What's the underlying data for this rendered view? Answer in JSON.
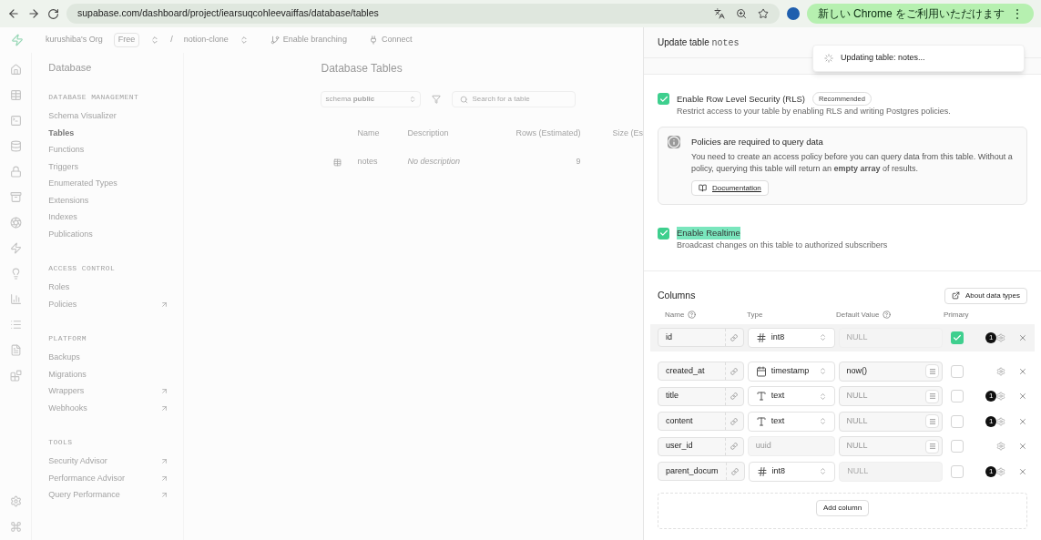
{
  "browser": {
    "url": "supabase.com/dashboard/project/iearsuqcohleevaiffas/database/tables",
    "update_banner": "新しい Chrome をご利用いただけます",
    "menu_glyph": "⋮"
  },
  "app_header": {
    "org": "kurushiba's Org",
    "plan": "Free",
    "separator": "/",
    "project": "notion-clone",
    "branching": "Enable branching",
    "connect": "Connect"
  },
  "sidebar": {
    "title": "Database",
    "sections": [
      {
        "heading": "DATABASE MANAGEMENT",
        "items": [
          {
            "label": "Schema Visualizer",
            "selected": false,
            "external": false
          },
          {
            "label": "Tables",
            "selected": true,
            "external": false
          },
          {
            "label": "Functions",
            "selected": false,
            "external": false
          },
          {
            "label": "Triggers",
            "selected": false,
            "external": false
          },
          {
            "label": "Enumerated Types",
            "selected": false,
            "external": false
          },
          {
            "label": "Extensions",
            "selected": false,
            "external": false
          },
          {
            "label": "Indexes",
            "selected": false,
            "external": false
          },
          {
            "label": "Publications",
            "selected": false,
            "external": false
          }
        ]
      },
      {
        "heading": "ACCESS CONTROL",
        "items": [
          {
            "label": "Roles",
            "selected": false,
            "external": false
          },
          {
            "label": "Policies",
            "selected": false,
            "external": true
          }
        ]
      },
      {
        "heading": "PLATFORM",
        "items": [
          {
            "label": "Backups",
            "selected": false,
            "external": false
          },
          {
            "label": "Migrations",
            "selected": false,
            "external": false
          },
          {
            "label": "Wrappers",
            "selected": false,
            "external": true
          },
          {
            "label": "Webhooks",
            "selected": false,
            "external": true
          }
        ]
      },
      {
        "heading": "TOOLS",
        "items": [
          {
            "label": "Security Advisor",
            "selected": false,
            "external": true
          },
          {
            "label": "Performance Advisor",
            "selected": false,
            "external": true
          },
          {
            "label": "Query Performance",
            "selected": false,
            "external": true
          }
        ]
      }
    ]
  },
  "main": {
    "title": "Database Tables",
    "schema": "schema **public**",
    "search": {
      "placeholder": "Search for a table"
    },
    "columns": [
      "Name",
      "Description",
      "Rows (Estimated)",
      "Size (Es"
    ],
    "rows": [
      {
        "name": "notes",
        "description": "No description",
        "rows": "9"
      }
    ]
  },
  "panel": {
    "title": "Update table",
    "table_name": "notes",
    "toast": "Updating table: notes...",
    "rls": {
      "checked": true,
      "label": "Enable Row Level Security (RLS)",
      "badge": "Recommended",
      "description": "Restrict access to your table by enabling RLS and writing Postgres policies."
    },
    "notice": {
      "title": "Policies are required to query data",
      "text": "You need to create an access policy before you can query data from this table. Without a policy, querying this table will return an **empty array** of results.",
      "button": "Documentation"
    },
    "realtime": {
      "checked": true,
      "label": "Enable Realtime",
      "description": "Broadcast changes on this table to authorized subscribers"
    },
    "columns_title": "Columns",
    "about_button": "About data types",
    "headers": [
      "Name",
      "Type",
      "Default Value",
      "Primary"
    ],
    "columns": [
      {
        "name": "id",
        "type": "int8",
        "kind": "hash",
        "type_disabled": false,
        "default_placeholder": "NULL",
        "default_disabled": true,
        "default_menu": false,
        "primary": true,
        "badge": "1",
        "highlighted": true
      },
      {
        "name": "created_at",
        "type": "timestamp",
        "kind": "calendar",
        "type_disabled": false,
        "default_value": "now()",
        "default_disabled": false,
        "default_menu": true,
        "primary": false,
        "highlighted": false
      },
      {
        "name": "title",
        "type": "text",
        "kind": "text",
        "type_disabled": false,
        "default_placeholder": "NULL",
        "default_disabled": false,
        "default_menu": true,
        "primary": false,
        "badge": "1",
        "highlighted": false
      },
      {
        "name": "content",
        "type": "text",
        "kind": "text",
        "type_disabled": false,
        "default_placeholder": "NULL",
        "default_disabled": false,
        "default_menu": true,
        "primary": false,
        "badge": "1",
        "highlighted": false
      },
      {
        "name": "user_id",
        "type": "uuid",
        "kind": "plain",
        "type_disabled": true,
        "default_placeholder": "NULL",
        "default_disabled": false,
        "default_menu": true,
        "primary": false,
        "highlighted": false
      },
      {
        "name": "parent_docum",
        "type": "int8",
        "kind": "hash",
        "type_disabled": false,
        "default_placeholder": "NULL",
        "default_disabled": true,
        "default_menu": false,
        "primary": false,
        "badge": "1",
        "highlighted": false
      }
    ],
    "add_column": "Add column"
  }
}
